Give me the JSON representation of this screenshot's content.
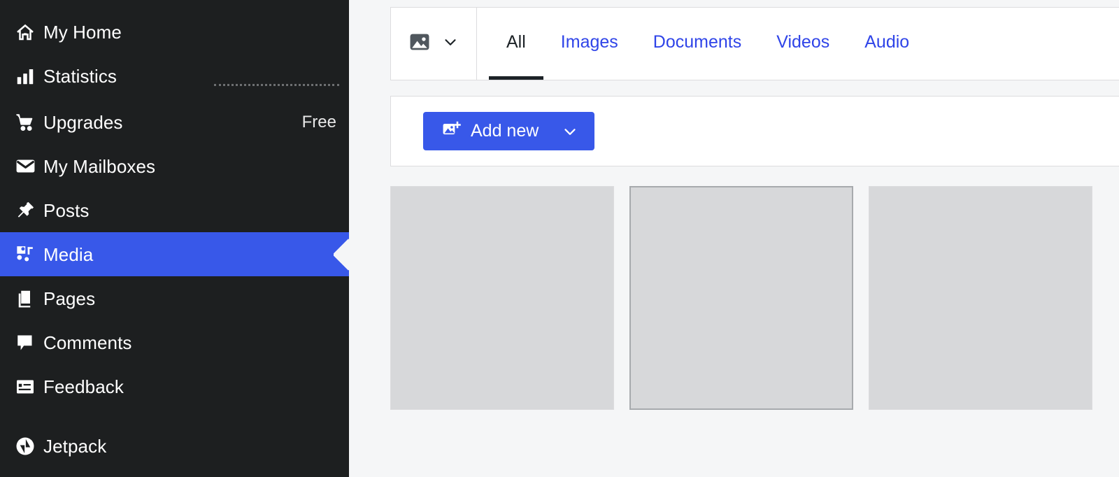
{
  "colors": {
    "accent_blue": "#3858e9",
    "link_blue": "#2f44e8",
    "sidebar_bg": "#1d1f20",
    "content_bg": "#f5f6f7",
    "panel_bg": "#ffffff",
    "panel_border": "#dcdcde",
    "tile_fill": "#d7d8da",
    "tile_selected_border": "#a7aaad",
    "active_tab_text": "#1d2327"
  },
  "sidebar": {
    "items": [
      {
        "label": "My Home",
        "icon": "house-icon",
        "badge": "",
        "selected": false
      },
      {
        "label": "Statistics",
        "icon": "bar-chart-icon",
        "badge": "",
        "selected": false
      },
      {
        "label": "Upgrades",
        "icon": "cart-icon",
        "badge": "Free",
        "selected": false
      },
      {
        "label": "My Mailboxes",
        "icon": "envelope-icon",
        "badge": "",
        "selected": false
      },
      {
        "label": "Posts",
        "icon": "pin-icon",
        "badge": "",
        "selected": false
      },
      {
        "label": "Media",
        "icon": "media-icon",
        "badge": "",
        "selected": true
      },
      {
        "label": "Pages",
        "icon": "pages-icon",
        "badge": "",
        "selected": false
      },
      {
        "label": "Comments",
        "icon": "comment-icon",
        "badge": "",
        "selected": false
      },
      {
        "label": "Feedback",
        "icon": "feedback-icon",
        "badge": "",
        "selected": false
      },
      {
        "label": "Jetpack",
        "icon": "jetpack-icon",
        "badge": "",
        "selected": false
      }
    ]
  },
  "main": {
    "media_switcher": {
      "icon": "image-icon",
      "caret_icon": "chevron-down-icon"
    },
    "tabs": [
      {
        "label": "All",
        "active": true
      },
      {
        "label": "Images",
        "active": false
      },
      {
        "label": "Documents",
        "active": false
      },
      {
        "label": "Videos",
        "active": false
      },
      {
        "label": "Audio",
        "active": false
      }
    ],
    "actions": {
      "add_new_label": "Add new",
      "add_new_icon": "add-image-icon",
      "add_new_caret_icon": "chevron-down-icon"
    },
    "grid": {
      "tiles": [
        {
          "selected": false
        },
        {
          "selected": true
        },
        {
          "selected": false
        }
      ]
    }
  }
}
